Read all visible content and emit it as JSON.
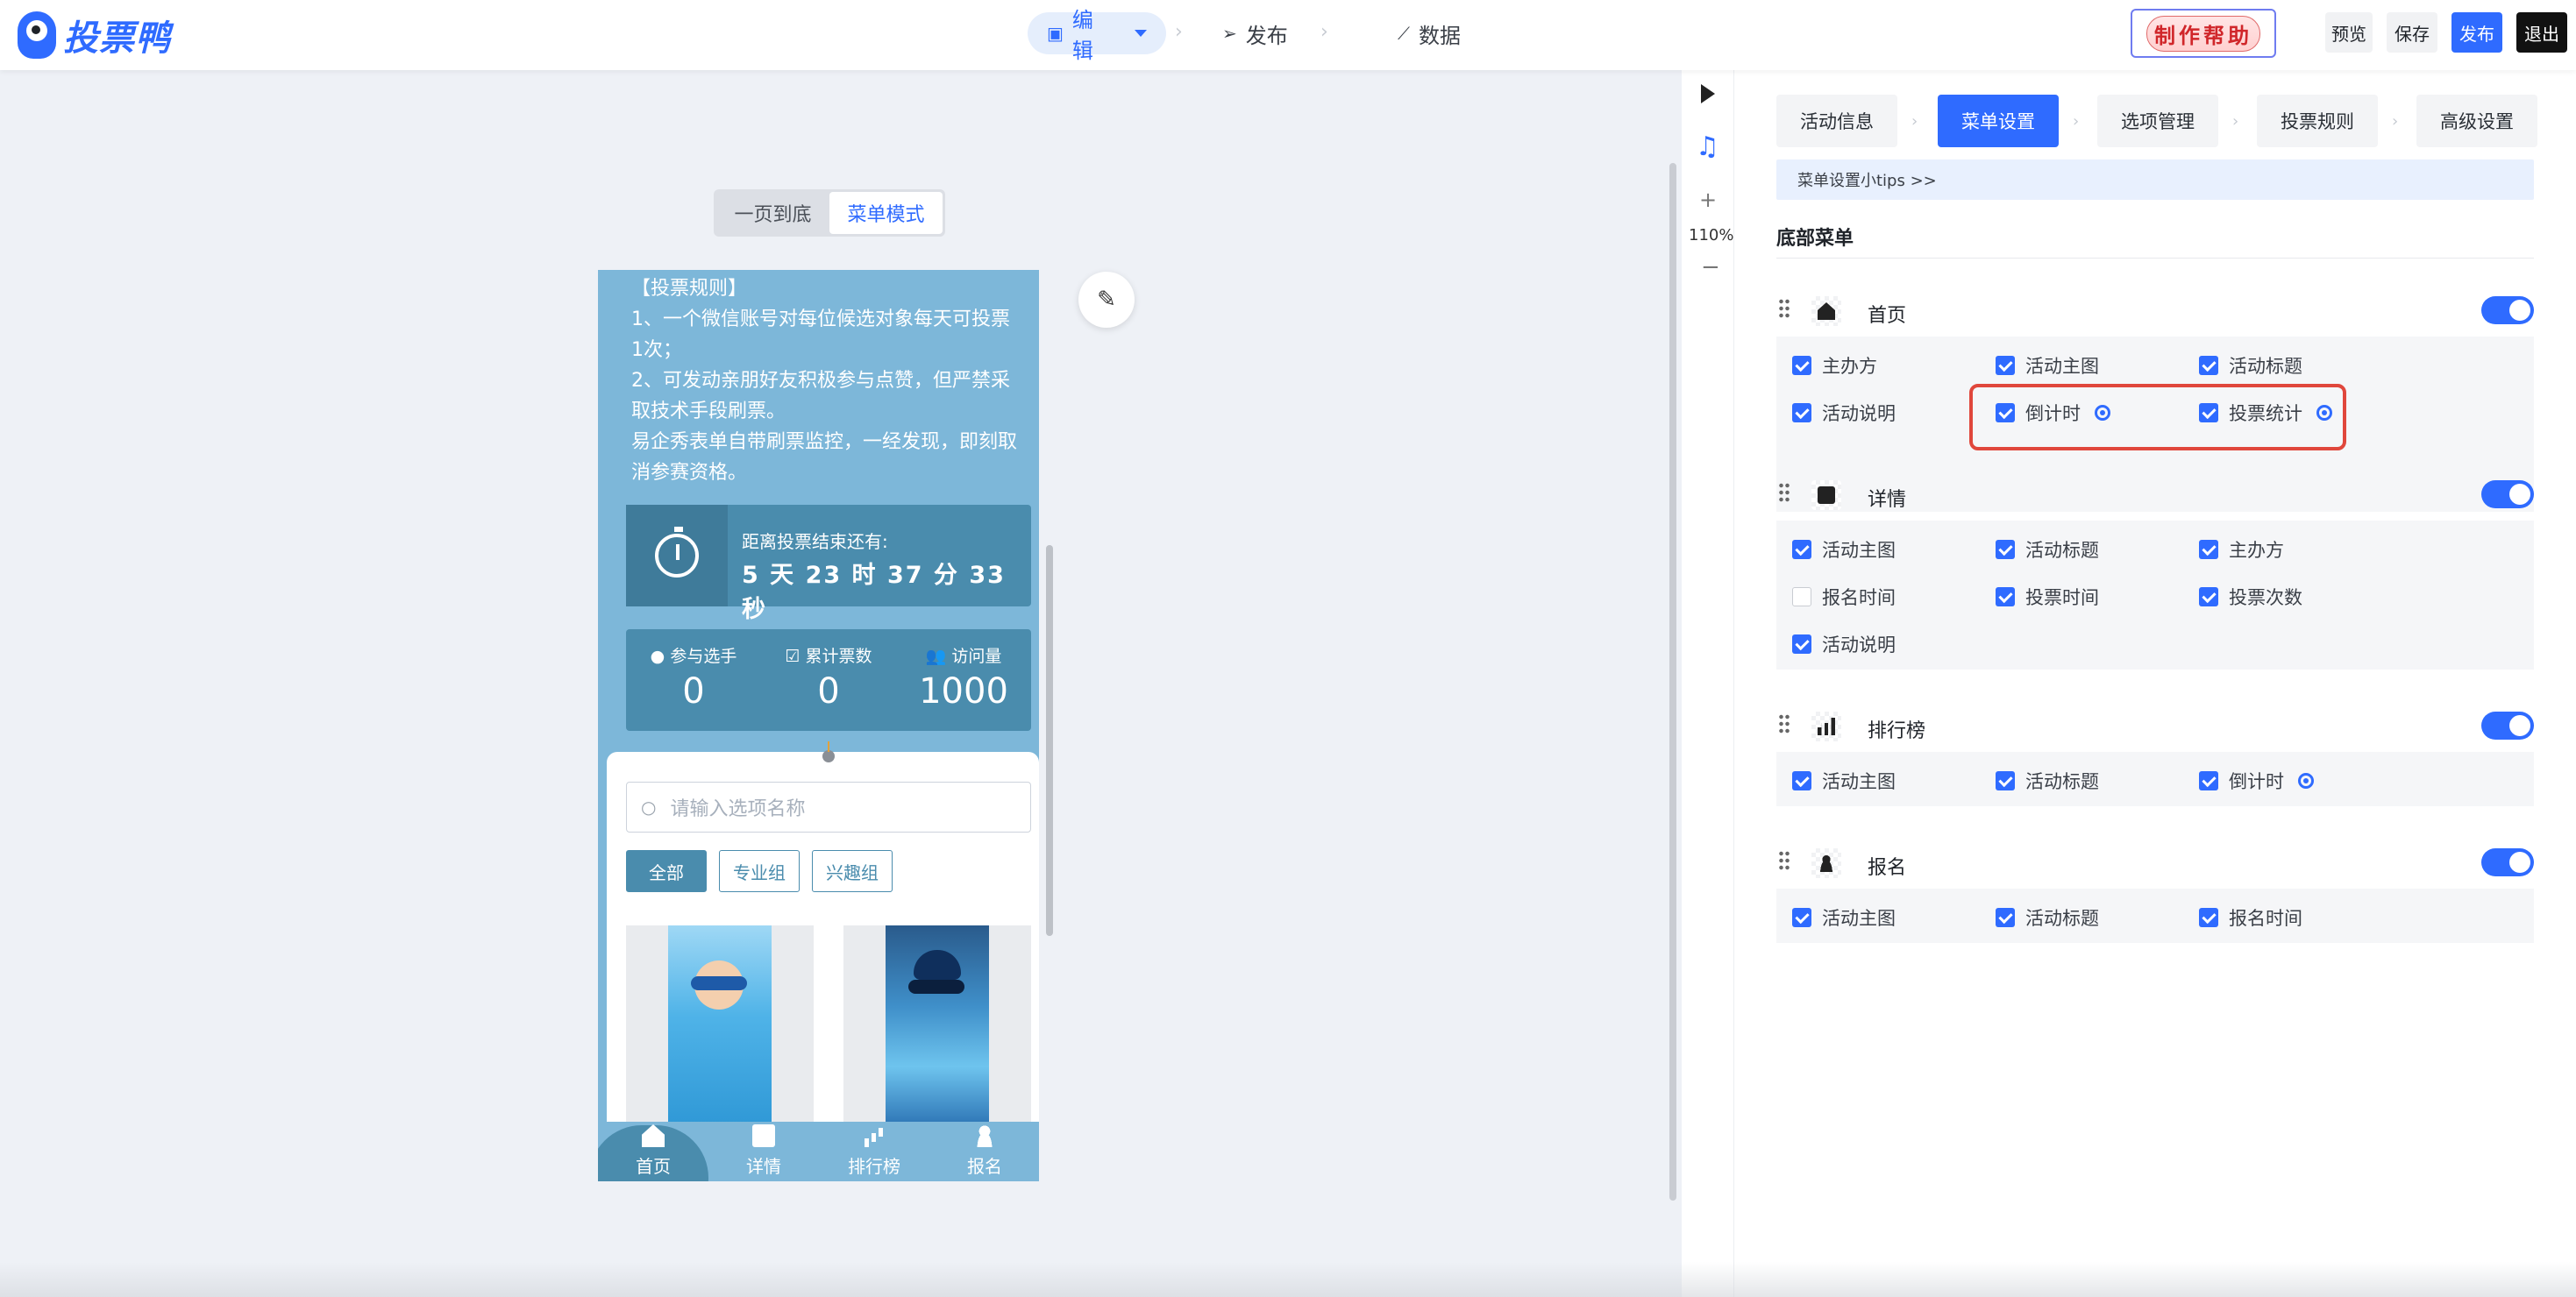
{
  "header": {
    "logo_text": "投票鸭",
    "nav": [
      {
        "label": "编辑",
        "active": true
      },
      {
        "label": "发布"
      },
      {
        "label": "数据"
      }
    ],
    "help_badge": "制作帮助",
    "buttons": {
      "preview": "预览",
      "save": "保存",
      "publish": "发布",
      "exit": "退出"
    }
  },
  "canvas": {
    "mode_switch": [
      {
        "label": "一页到底"
      },
      {
        "label": "菜单模式",
        "active": true
      }
    ],
    "rules_text": [
      "【投票规则】",
      "1、一个微信账号对每位候选对象每天可投票1次；",
      "2、可发动亲朋好友积极参与点赞，但严禁采取技术手段刷票。",
      "易企秀表单自带刷票监控，一经发现，即刻取消参赛资格。"
    ],
    "countdown": {
      "label": "距离投票结束还有:",
      "time": "5 天 23 时 37 分 33 秒"
    },
    "stats": [
      {
        "label": "参与选手",
        "value": "0",
        "icon": "user-circle-icon"
      },
      {
        "label": "累计票数",
        "value": "0",
        "icon": "check-square-icon"
      },
      {
        "label": "访问量",
        "value": "1000",
        "icon": "users-icon"
      }
    ],
    "search_placeholder": "请输入选项名称",
    "filter_tags": [
      {
        "label": "全部",
        "active": true
      },
      {
        "label": "专业组"
      },
      {
        "label": "兴趣组"
      }
    ],
    "tabbar": [
      {
        "label": "首页",
        "active": true,
        "icon": "home-icon"
      },
      {
        "label": "详情",
        "icon": "document-icon"
      },
      {
        "label": "排行榜",
        "icon": "bar-chart-icon"
      },
      {
        "label": "报名",
        "icon": "user-add-icon"
      }
    ],
    "zoom": "110%",
    "accent_color": "#4a8cad"
  },
  "panel": {
    "tabs": [
      {
        "label": "活动信息"
      },
      {
        "label": "菜单设置",
        "active": true
      },
      {
        "label": "选项管理"
      },
      {
        "label": "投票规则"
      },
      {
        "label": "高级设置"
      }
    ],
    "tips": "菜单设置小tips  >>",
    "section_title": "底部菜单",
    "groups": [
      {
        "name": "首页",
        "icon": "home-icon",
        "enabled": true,
        "options": [
          {
            "label": "主办方",
            "checked": true
          },
          {
            "label": "活动主图",
            "checked": true
          },
          {
            "label": "活动标题",
            "checked": true
          },
          {
            "label": "活动说明",
            "checked": true
          },
          {
            "label": "倒计时",
            "checked": true,
            "has_settings": true
          },
          {
            "label": "投票统计",
            "checked": true,
            "has_settings": true
          }
        ]
      },
      {
        "name": "详情",
        "icon": "document-icon",
        "enabled": true,
        "options": [
          {
            "label": "活动主图",
            "checked": true
          },
          {
            "label": "活动标题",
            "checked": true
          },
          {
            "label": "主办方",
            "checked": true
          },
          {
            "label": "报名时间",
            "checked": false
          },
          {
            "label": "投票时间",
            "checked": true
          },
          {
            "label": "投票次数",
            "checked": true
          },
          {
            "label": "活动说明",
            "checked": true
          }
        ]
      },
      {
        "name": "排行榜",
        "icon": "bar-chart-icon",
        "enabled": true,
        "options": [
          {
            "label": "活动主图",
            "checked": true
          },
          {
            "label": "活动标题",
            "checked": true
          },
          {
            "label": "倒计时",
            "checked": true,
            "has_settings": true
          }
        ]
      },
      {
        "name": "报名",
        "icon": "user-add-icon",
        "enabled": true,
        "options": [
          {
            "label": "活动主图",
            "checked": true
          },
          {
            "label": "活动标题",
            "checked": true
          },
          {
            "label": "报名时间",
            "checked": true
          }
        ]
      }
    ],
    "primary_color": "#2f6bff",
    "highlight_color": "#e0473c"
  }
}
